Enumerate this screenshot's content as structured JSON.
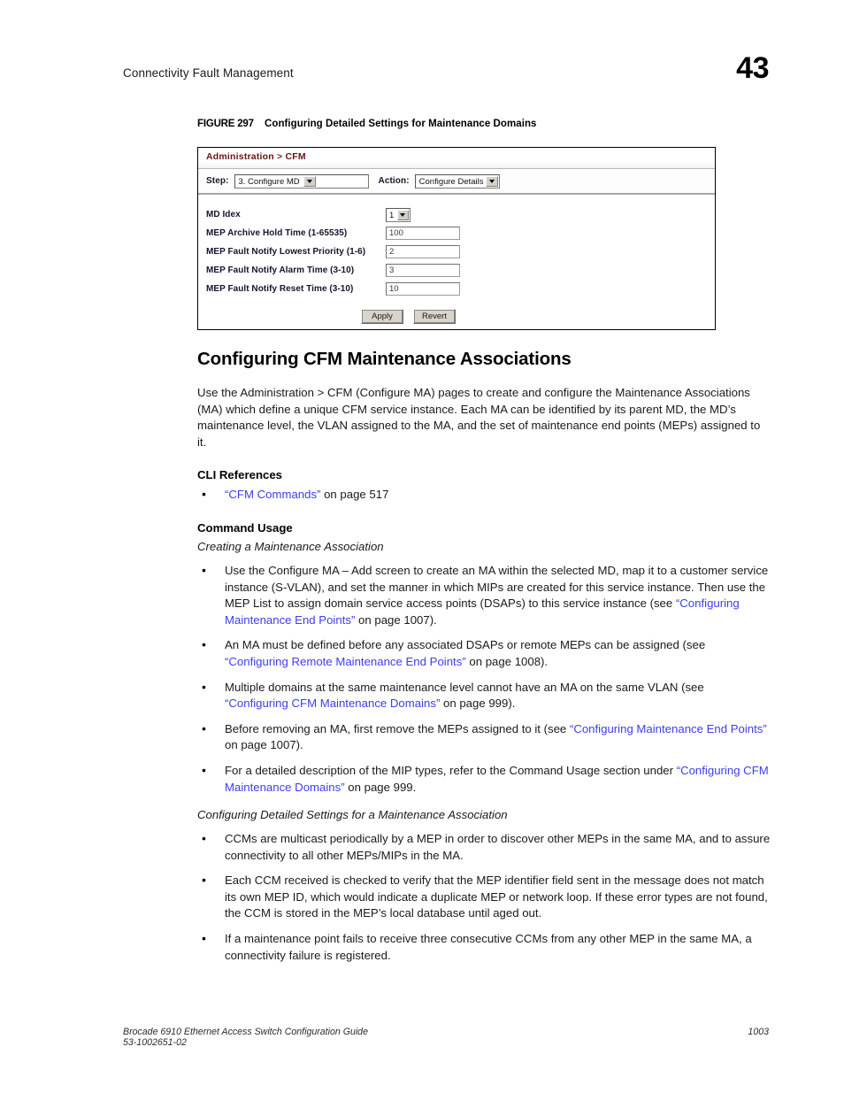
{
  "header": {
    "chapter_title": "Connectivity Fault Management",
    "chapter_number": "43"
  },
  "figure": {
    "label": "FIGURE 297",
    "title": "Configuring Detailed Settings for Maintenance Domains",
    "panel": {
      "breadcrumb_root": "Administration",
      "breadcrumb_sep": ">",
      "breadcrumb_leaf": "CFM",
      "step_label": "Step:",
      "step_value": "3. Configure MD",
      "action_label": "Action:",
      "action_value": "Configure Details",
      "fields": [
        {
          "label": "MD Idex",
          "value": "1",
          "control": "select"
        },
        {
          "label": "MEP Archive Hold Time (1-65535)",
          "value": "100",
          "control": "text"
        },
        {
          "label": "MEP Fault Notify Lowest Priority (1-6)",
          "value": "2",
          "control": "text"
        },
        {
          "label": "MEP Fault Notify Alarm Time (3-10)",
          "value": "3",
          "control": "text"
        },
        {
          "label": "MEP Fault Notify Reset Time (3-10)",
          "value": "10",
          "control": "text"
        }
      ],
      "apply_label": "Apply",
      "revert_label": "Revert"
    }
  },
  "content": {
    "section_title": "Configuring CFM Maintenance Associations",
    "intro_paragraph": "Use the Administration > CFM (Configure MA) pages to create and configure the Maintenance Associations (MA) which define a unique CFM service instance. Each MA can be identified by its parent MD, the MD’s maintenance level, the VLAN assigned to the MA, and the set of maintenance end points (MEPs) assigned to it.",
    "cli_references_heading": "CLI References",
    "cli_references": [
      {
        "link": "“CFM Commands”",
        "tail": " on page 517"
      }
    ],
    "command_usage_heading": "Command Usage",
    "creating_subhead": "Creating a Maintenance Association",
    "creating_bullets": [
      {
        "pre": "Use the Configure MA – Add screen to create an MA within the selected MD, map it to a customer service instance (S-VLAN), and set the manner in which MIPs are created for this service instance. Then use the MEP List to assign domain service access points (DSAPs) to this service instance (see ",
        "link": "“Configuring Maintenance End Points”",
        "post": " on page 1007)."
      },
      {
        "pre": "An MA must be defined before any associated DSAPs or remote MEPs can be assigned (see ",
        "link": "“Configuring Remote Maintenance End Points”",
        "post": " on page 1008)."
      },
      {
        "pre": "Multiple domains at the same maintenance level cannot have an MA on the same VLAN (see ",
        "link": "“Configuring CFM Maintenance Domains”",
        "post": " on page 999)."
      },
      {
        "pre": "Before removing an MA, first remove the MEPs assigned to it (see ",
        "link": "“Configuring Maintenance End Points”",
        "post": " on page 1007)."
      },
      {
        "pre": "For a detailed description of the MIP types, refer to the Command Usage section under ",
        "link": "“Configuring CFM Maintenance Domains”",
        "post": " on page 999."
      }
    ],
    "detailed_subhead": "Configuring Detailed Settings for a Maintenance Association",
    "detailed_bullets": [
      "CCMs are multicast periodically by a MEP in order to discover other MEPs in the same MA, and to assure connectivity to all other MEPs/MIPs in the MA.",
      "Each CCM received is checked to verify that the MEP identifier field sent in the message does not match its own MEP ID, which would indicate a duplicate MEP or network loop. If these error types are not found, the CCM is stored in the MEP’s local database until aged out.",
      "If a maintenance point fails to receive three consecutive CCMs from any other MEP in the same MA, a connectivity failure is registered."
    ]
  },
  "footer": {
    "guide_title": "Brocade 6910 Ethernet Access Switch Configuration Guide",
    "doc_number": "53-1002651-02",
    "page_number": "1003"
  },
  "colors": {
    "link": "#3d3df0",
    "panel_title": "#6b1414",
    "field_label": "#141430",
    "button_face": "#d8d4cc"
  }
}
